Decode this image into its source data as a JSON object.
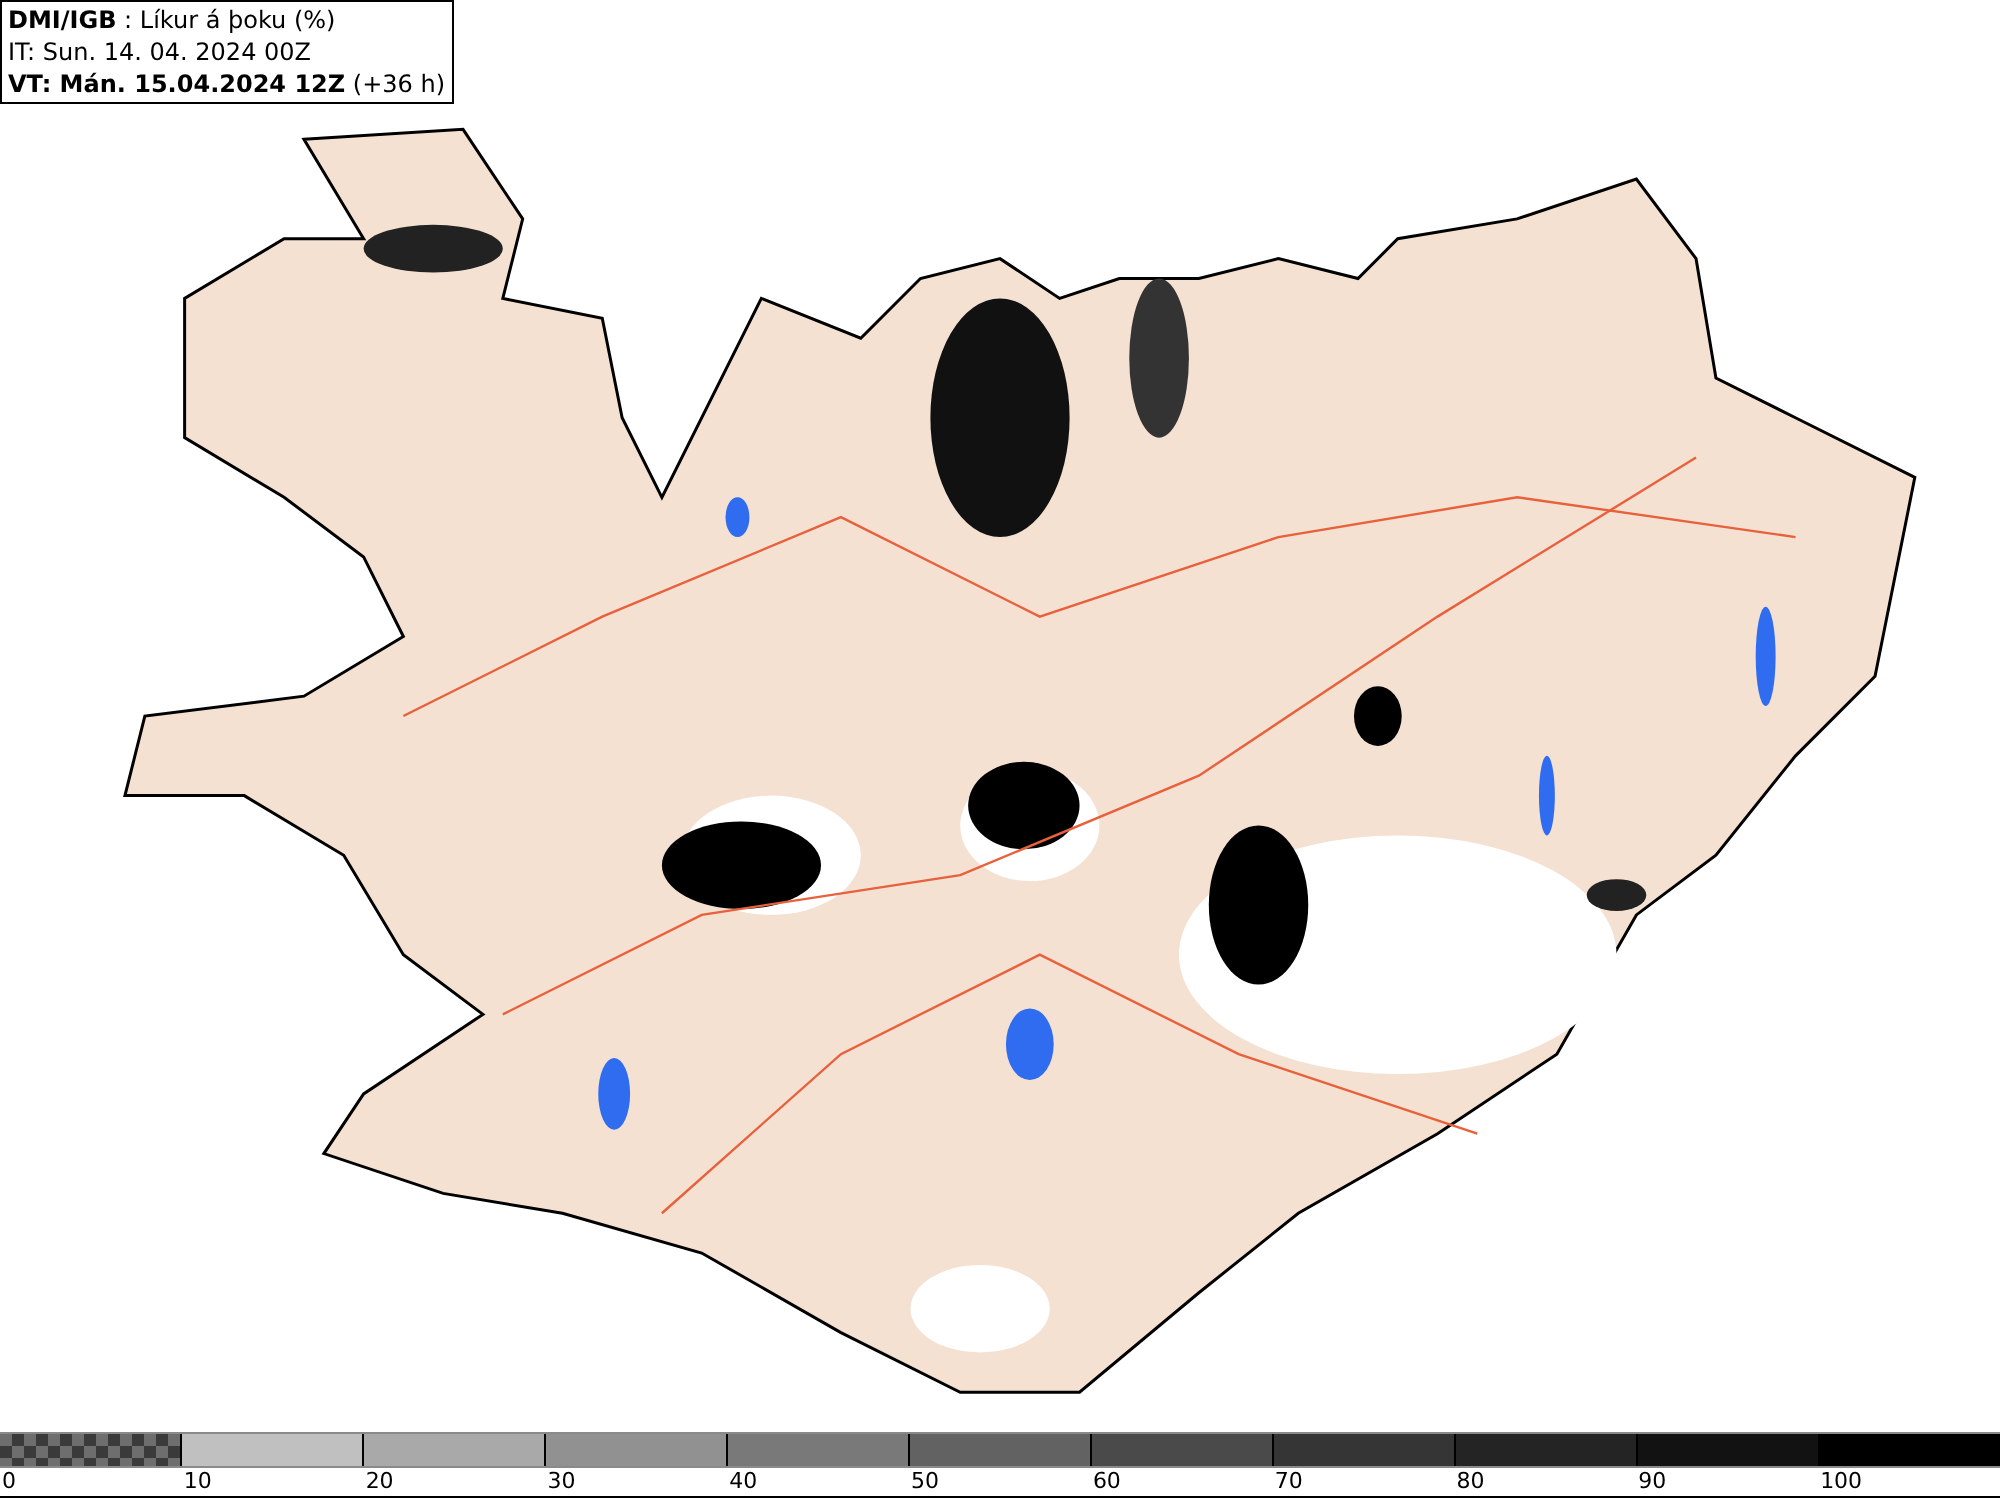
{
  "header": {
    "lines": [
      "**DMI/IGB** : Líkur á þoku (%)",
      "IT: Sun. 14. 04. 2024 00Z",
      "**VT: Mán. 15.04.2024 12Z** (+36 h)"
    ]
  },
  "legend": {
    "segments": [
      {
        "kind": "pattern",
        "color": "#6e6e6e",
        "label": "0"
      },
      {
        "kind": "solid",
        "color": "#c0c0c0",
        "label": "10"
      },
      {
        "kind": "solid",
        "color": "#a9a9a9",
        "label": "20"
      },
      {
        "kind": "solid",
        "color": "#919191",
        "label": "30"
      },
      {
        "kind": "solid",
        "color": "#797979",
        "label": "40"
      },
      {
        "kind": "solid",
        "color": "#626262",
        "label": "50"
      },
      {
        "kind": "solid",
        "color": "#4a4a4a",
        "label": "60"
      },
      {
        "kind": "solid",
        "color": "#353535",
        "label": "70"
      },
      {
        "kind": "solid",
        "color": "#242424",
        "label": "80"
      },
      {
        "kind": "solid",
        "color": "#121212",
        "label": "90"
      },
      {
        "kind": "solid",
        "color": "#000000",
        "label": "100"
      }
    ]
  }
}
